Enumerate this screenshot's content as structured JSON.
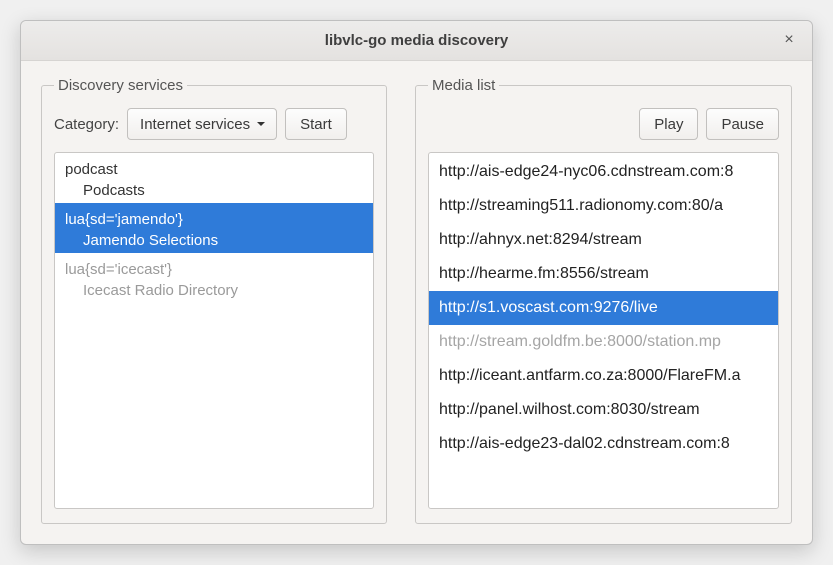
{
  "window": {
    "title": "libvlc-go media discovery"
  },
  "discovery": {
    "group_label": "Discovery services",
    "category_label": "Category:",
    "category_value": "Internet services",
    "start_label": "Start",
    "tree": [
      {
        "id": "podcast",
        "name": "podcast",
        "label": "Podcasts",
        "selected": false,
        "dim": false
      },
      {
        "id": "jamendo",
        "name": "lua{sd='jamendo'}",
        "label": "Jamendo Selections",
        "selected": true,
        "dim": false
      },
      {
        "id": "icecast",
        "name": "lua{sd='icecast'}",
        "label": "Icecast Radio Directory",
        "selected": false,
        "dim": true
      }
    ]
  },
  "media": {
    "group_label": "Media list",
    "play_label": "Play",
    "pause_label": "Pause",
    "items": [
      {
        "url": "http://ais-edge24-nyc06.cdnstream.com:8",
        "selected": false,
        "dim": false
      },
      {
        "url": "http://streaming511.radionomy.com:80/a",
        "selected": false,
        "dim": false
      },
      {
        "url": "http://ahnyx.net:8294/stream",
        "selected": false,
        "dim": false
      },
      {
        "url": "http://hearme.fm:8556/stream",
        "selected": false,
        "dim": false
      },
      {
        "url": "http://s1.voscast.com:9276/live",
        "selected": true,
        "dim": false
      },
      {
        "url": "http://stream.goldfm.be:8000/station.mp",
        "selected": false,
        "dim": true
      },
      {
        "url": "http://iceant.antfarm.co.za:8000/FlareFM.a",
        "selected": false,
        "dim": false
      },
      {
        "url": "http://panel.wilhost.com:8030/stream",
        "selected": false,
        "dim": false
      },
      {
        "url": "http://ais-edge23-dal02.cdnstream.com:8",
        "selected": false,
        "dim": false
      }
    ]
  }
}
